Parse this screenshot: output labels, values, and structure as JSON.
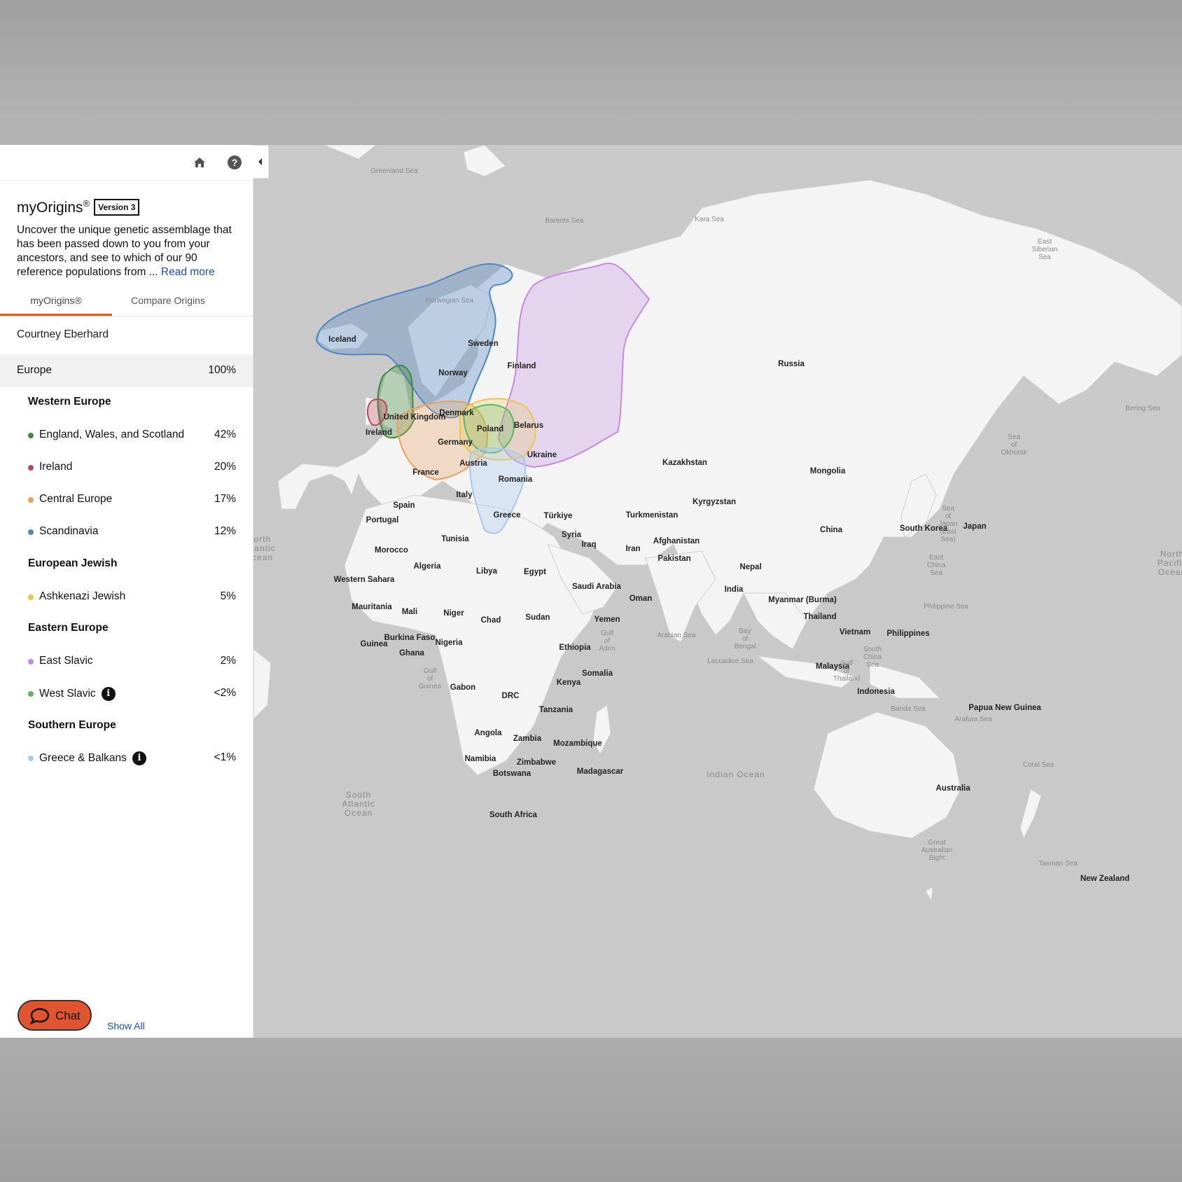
{
  "app": {
    "title": "myOrigins",
    "title_mark": "®",
    "version": "Version 3",
    "description": "Uncover the unique genetic assemblage that has been passed down to you from your ancestors, and see to which of our 90 reference populations from ... ",
    "read_more": "Read more"
  },
  "tabs": [
    {
      "label": "myOrigins®",
      "active": true
    },
    {
      "label": "Compare Origins",
      "active": false
    }
  ],
  "user_name": "Courtney Eberhard",
  "region": {
    "label": "Europe",
    "percent": "100%"
  },
  "groups": [
    {
      "label": "Western Europe"
    },
    {
      "label": "European Jewish"
    },
    {
      "label": "Eastern Europe"
    },
    {
      "label": "Southern Europe"
    }
  ],
  "items": [
    {
      "label": "England, Wales, and Scotland",
      "percent": "42%",
      "color": "#3c8a3c"
    },
    {
      "label": "Ireland",
      "percent": "20%",
      "color": "#b94a5c"
    },
    {
      "label": "Central Europe",
      "percent": "17%",
      "color": "#e8a05a"
    },
    {
      "label": "Scandinavia",
      "percent": "12%",
      "color": "#4f86c6"
    },
    {
      "label": "Ashkenazi Jewish",
      "percent": "5%",
      "color": "#e8c84a"
    },
    {
      "label": "East Slavic",
      "percent": "2%",
      "color": "#c58be0"
    },
    {
      "label": "West Slavic",
      "percent": "<2%",
      "color": "#5cb85c"
    },
    {
      "label": "Greece & Balkans",
      "percent": "<1%",
      "color": "#a8c8f0"
    }
  ],
  "footer": {
    "chat_label": "Chat",
    "show_all": "Show All"
  },
  "icons": {
    "home": "home-icon",
    "help": "help-icon",
    "collapse": "chevron-left-icon",
    "chat": "chat-bubble-icon",
    "info": "info-icon"
  },
  "map": {
    "countries": [
      "Iceland",
      "Sweden",
      "Norway",
      "Finland",
      "Russia",
      "United Kingdom",
      "Denmark",
      "Ireland",
      "Poland",
      "Belarus",
      "Germany",
      "Ukraine",
      "Austria",
      "Romania",
      "France",
      "Italy",
      "Spain",
      "Portugal",
      "Greece",
      "Türkiye",
      "Kazakhstan",
      "Mongolia",
      "Kyrgyzstan",
      "Turkmenistan",
      "Tunisia",
      "Syria",
      "Iraq",
      "Iran",
      "Afghanistan",
      "Pakistan",
      "China",
      "South Korea",
      "Japan",
      "Morocco",
      "Algeria",
      "Libya",
      "Egypt",
      "Western Sahara",
      "Nepal",
      "Saudi Arabia",
      "Oman",
      "India",
      "Myanmar (Burma)",
      "Mauritania",
      "Mali",
      "Niger",
      "Chad",
      "Sudan",
      "Yemen",
      "Thailand",
      "Vietnam",
      "Philippines",
      "Burkina Faso",
      "Nigeria",
      "Guinea",
      "Ghana",
      "Ethiopia",
      "Somalia",
      "Malaysia",
      "Gabon",
      "DRC",
      "Kenya",
      "Indonesia",
      "Tanzania",
      "Papua New Guinea",
      "Angola",
      "Zambia",
      "Mozambique",
      "Namibia",
      "Zimbabwe",
      "Botswana",
      "Madagascar",
      "Australia",
      "South Africa",
      "New Zealand"
    ],
    "seas": [
      "Greenland Sea",
      "Barents Sea",
      "Kara Sea",
      "East Siberian Sea",
      "Norwegian Sea",
      "Bering Sea",
      "Sea of Okhotsk",
      "Sea of Japan (East Sea)",
      "East China Sea",
      "Philippine Sea",
      "Gulf of Aden",
      "Arabian Sea",
      "Bay of Bengal",
      "South China Sea",
      "Gulf of Thailand",
      "Laccadive Sea",
      "Gulf of Guinea",
      "Banda Sea",
      "Arafura Sea",
      "Coral Sea",
      "Great Australian Bight",
      "Tasman Sea"
    ],
    "oceans": [
      "North Atlantic Ocean",
      "South Atlantic Ocean",
      "Indian Ocean",
      "North Pacific Ocean"
    ]
  }
}
